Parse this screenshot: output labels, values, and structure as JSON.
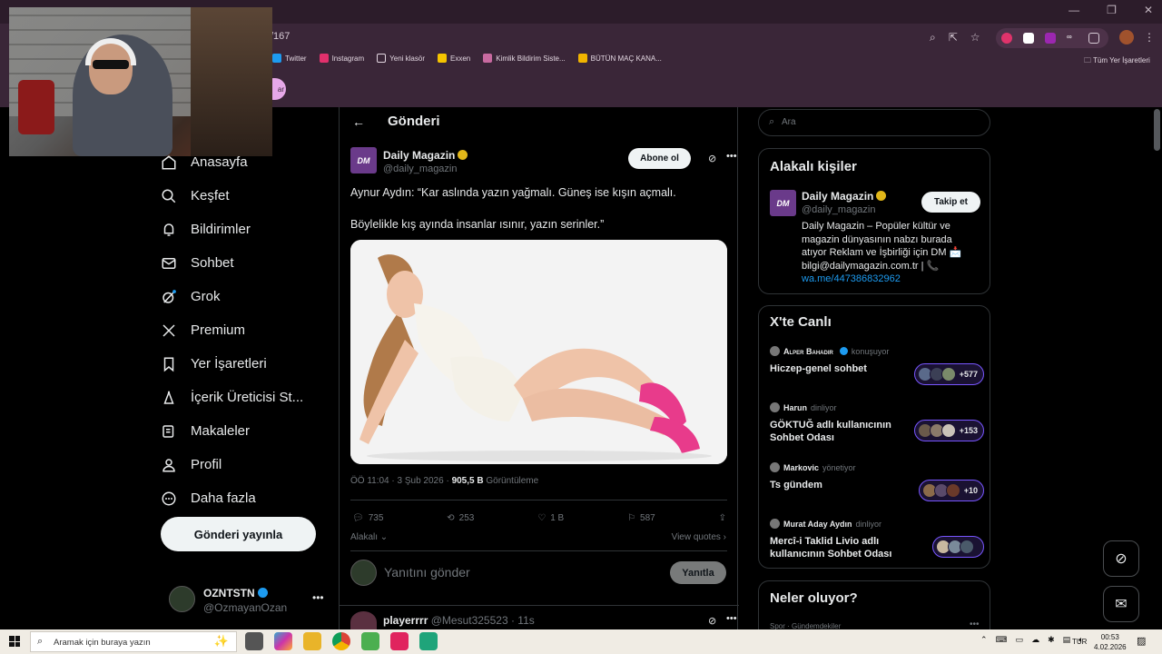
{
  "browser": {
    "url_fragment": "/167",
    "bookmarks": [
      {
        "label": "Twitter",
        "color": "#1d9bf0"
      },
      {
        "label": "Instagram",
        "color": "#e1306c"
      },
      {
        "label": "Yeni klasör",
        "color": "#e2d6e0"
      },
      {
        "label": "Exxen",
        "color": "#f5c400"
      },
      {
        "label": "Kimlik Bildirim Siste...",
        "color": "#c86aa0"
      },
      {
        "label": "BÜTÜN MAÇ KANA...",
        "color": "#f1b400"
      }
    ],
    "all_bookmarks": "Tüm Yer İşaretleri",
    "tab_pill_text": "ar"
  },
  "sidebar": {
    "items": [
      {
        "label": "Anasayfa",
        "icon": "home-icon"
      },
      {
        "label": "Keşfet",
        "icon": "search-icon"
      },
      {
        "label": "Bildirimler",
        "icon": "bell-icon"
      },
      {
        "label": "Sohbet",
        "icon": "mail-icon"
      },
      {
        "label": "Grok",
        "icon": "grok-icon"
      },
      {
        "label": "Premium",
        "icon": "x-icon"
      },
      {
        "label": "Yer İşaretleri",
        "icon": "bookmark-icon"
      },
      {
        "label": "İçerik Üreticisi St...",
        "icon": "creator-icon"
      },
      {
        "label": "Makaleler",
        "icon": "article-icon"
      },
      {
        "label": "Profil",
        "icon": "person-icon"
      },
      {
        "label": "Daha fazla",
        "icon": "more-circle-icon"
      }
    ],
    "post_button": "Gönderi yayınla",
    "account": {
      "name": "OZNTSTN",
      "handle": "@OzmayanOzan"
    }
  },
  "main": {
    "title": "Gönderi",
    "author": {
      "name": "Daily Magazin",
      "handle": "@daily_magazin",
      "logo_text": "DM"
    },
    "subscribe_button": "Abone ol",
    "text_line1": "Aynur Aydın: “Kar aslında yazın yağmalı. Güneş ise kışın açmalı.",
    "text_line2": "Böylelikle kış ayında insanlar ısınır, yazın serinler.”",
    "meta": {
      "time": "ÖÖ 11:04 · 3 Şub 2026 · ",
      "views": "905,5 B",
      "views_label": " Görüntüleme"
    },
    "actions": {
      "replies": "735",
      "reposts": "253",
      "likes": "1 B",
      "bookmarks": "587"
    },
    "related_label": "Alakalı",
    "quotes_label": "View quotes",
    "reply_placeholder": "Yanıtını gönder",
    "reply_button": "Yanıtla",
    "next_post": {
      "name": "playerrrr",
      "handle": "@Mesut325523",
      "time": "11s"
    }
  },
  "right": {
    "search_placeholder": "Ara",
    "related_title": "Alakalı kişiler",
    "related_person": {
      "name": "Daily Magazin",
      "handle": "@daily_magazin",
      "bio": "Daily Magazin – Popüler kültür ve magazin dünyasının nabzı burada atıyor Reklam ve İşbirliği için DM 📩 bilgi@dailymagazin.com.tr | 📞",
      "link": "wa.me/447386832962",
      "follow_button": "Takip et"
    },
    "live_title": "X'te Canlı",
    "spaces": [
      {
        "host": "Alper Bahadır",
        "role": "konuşuyor",
        "title": "Hiczep-genel sohbet",
        "count": "+577"
      },
      {
        "host": "Harun",
        "role": "dinliyor",
        "title": "GÖKTUĞ adlı kullanıcının Sohbet Odası",
        "count": "+153"
      },
      {
        "host": "Markovic",
        "role": "yönetiyor",
        "title": "Ts gündem",
        "count": "+10"
      },
      {
        "host": "Murat Aday Aydın",
        "role": "dinliyor",
        "title": "Mercî-i Taklid Livio adlı kullanıcının Sohbet Odası",
        "count": ""
      }
    ],
    "trends_title": "Neler oluyor?",
    "trends_sub": "Spor · Gündemdekiler"
  },
  "taskbar": {
    "search_placeholder": "Aramak için buraya yazın",
    "lang": "TUR",
    "time": "00:53",
    "date": "4.02.2026"
  },
  "colors": {
    "accent": "#1d9bf0",
    "verified_gold": "#e2b719",
    "space_border": "#7856ff"
  }
}
